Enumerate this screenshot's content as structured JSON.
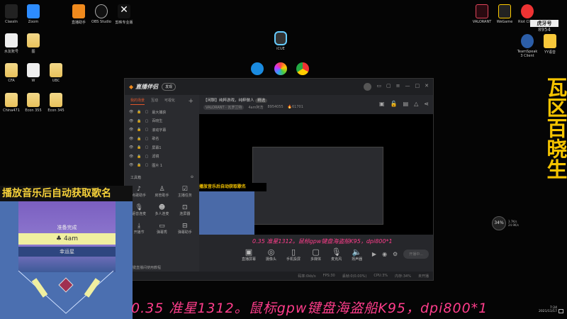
{
  "desktop_icons": [
    "ClassIn",
    "Zoom",
    "直播助手",
    "OBS Studio",
    "剪映专业版",
    "水友账号",
    "图",
    "CFA",
    "W",
    "UBC",
    "China471",
    "Econ 355",
    "Econ 345",
    "iCUE",
    "VALORANT",
    "WeGame",
    "Riot Client",
    "TeamSpeak 3 Client",
    "YY语音"
  ],
  "huya": {
    "label": "虎牙号",
    "id": "8954"
  },
  "vertical_title": "瓦区百晓生",
  "app": {
    "title": "直播伴侣",
    "badge": "发现",
    "sidebar_tabs": [
      "我的场景",
      "互动",
      "可视化"
    ],
    "sources": [
      "最大捕获",
      "百晓生",
      "滚动字幕",
      "歌名",
      "屏幕1",
      "滤镜",
      "图片 1"
    ],
    "tools_label": "工具箱",
    "tools": [
      "点歌助手",
      "房管助手",
      "主播任务",
      "语音连麦",
      "多人连麦",
      "连屏器",
      "开播节",
      "弹幕秀",
      "弹幕助手"
    ],
    "tutorial": "一键直播间使用教程",
    "stream_title": "【闲聊】纯粹游戏，纯粹做人",
    "stream_tag": "精选",
    "category": "VALORANT · 瓦罗兰特",
    "room_owner": "4am阿浩",
    "room_id": "8954055",
    "popularity": "61701",
    "controls": [
      "直播屏幕",
      "摄像头",
      "手机投屏",
      "多媒体",
      "麦克风",
      "扬声器"
    ],
    "go_live": "开播中...",
    "status": [
      "码率:0kb/s",
      "FPS:30",
      "丢帧:0(0.00%)",
      "CPU:3%",
      "内存:34%",
      "未开播"
    ]
  },
  "overlay": {
    "caption": "播放音乐后自动获取歌名",
    "state": "准备完成",
    "song": "4am",
    "sub": "幸运星"
  },
  "ticker": "0.35 准星1312。鼠标gpw键盘海盗船K95，dpi800*1",
  "perf": {
    "percent": "34%",
    "up": "3.7K/s",
    "down": "24.9K/s"
  },
  "clock": {
    "time": "7:24",
    "date": "2021/11/17"
  },
  "colors": {
    "accent": "#e0562b",
    "yellow": "#f5c400",
    "pink": "#ff3d8b"
  }
}
